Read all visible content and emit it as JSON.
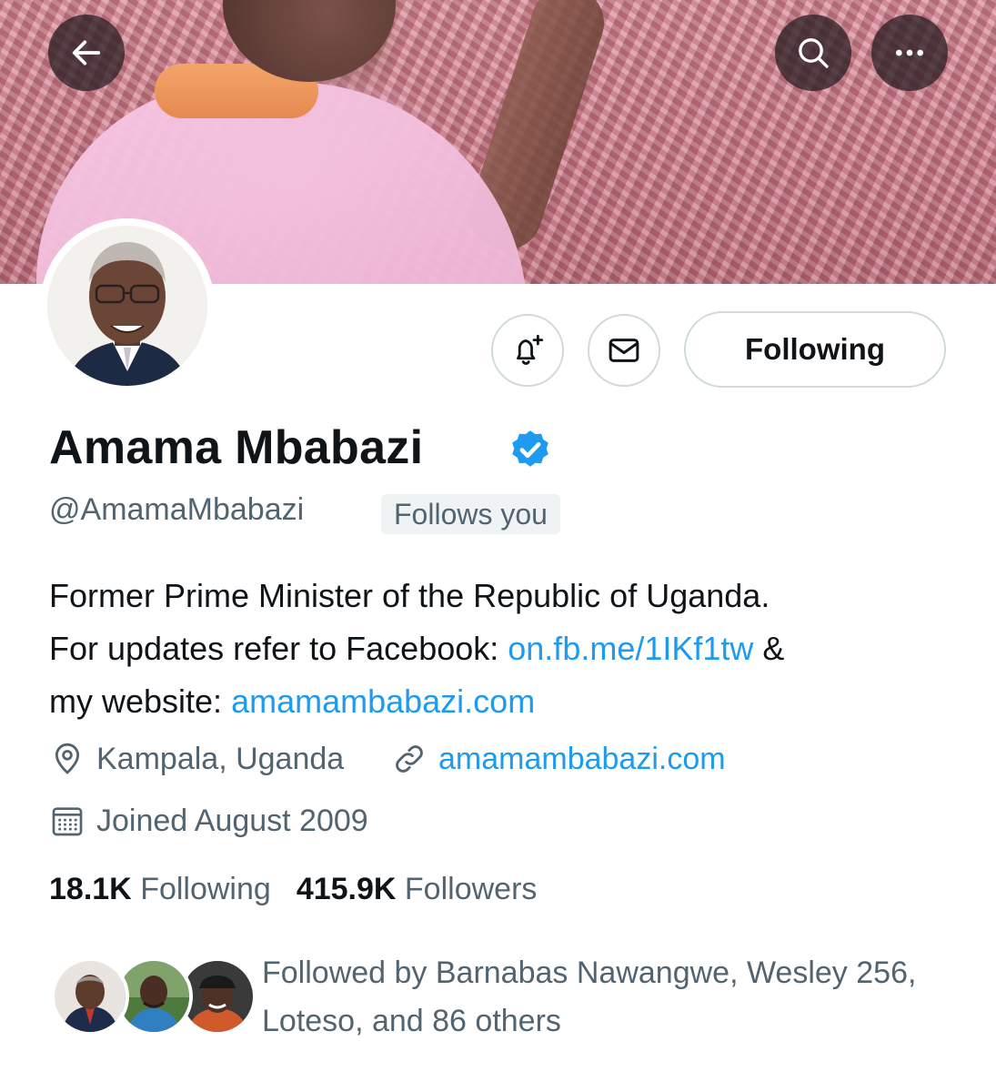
{
  "header": {
    "back_icon": "arrow-left-icon",
    "search_icon": "search-icon",
    "more_icon": "more-horizontal-icon"
  },
  "actions": {
    "notify_icon": "bell-plus-icon",
    "message_icon": "mail-icon",
    "follow_label": "Following"
  },
  "profile": {
    "name": "Amama Mbabazi",
    "handle": "@AmamaMbabazi",
    "follows_you": "Follows you",
    "bio_line1": "Former Prime Minister of the Republic of Uganda.",
    "bio_line2_prefix": "For updates refer to Facebook: ",
    "bio_link1": "on.fb.me/1IKf1tw",
    "bio_line2_suffix": " &",
    "bio_line3_prefix": "my website: ",
    "bio_link2": "amamambabazi.com",
    "location": "Kampala, Uganda",
    "website": "amamambabazi.com",
    "joined": "Joined August 2009"
  },
  "stats": {
    "following_count": "18.1K",
    "following_label": "Following",
    "followers_count": "415.9K",
    "followers_label": "Followers"
  },
  "followed_by": {
    "text": "Followed by Barnabas Nawangwe, Wesley 256, Loteso, and 86 others"
  },
  "colors": {
    "accent": "#1d9bf0",
    "secondary_text": "#536471",
    "primary_text": "#0f1419"
  }
}
